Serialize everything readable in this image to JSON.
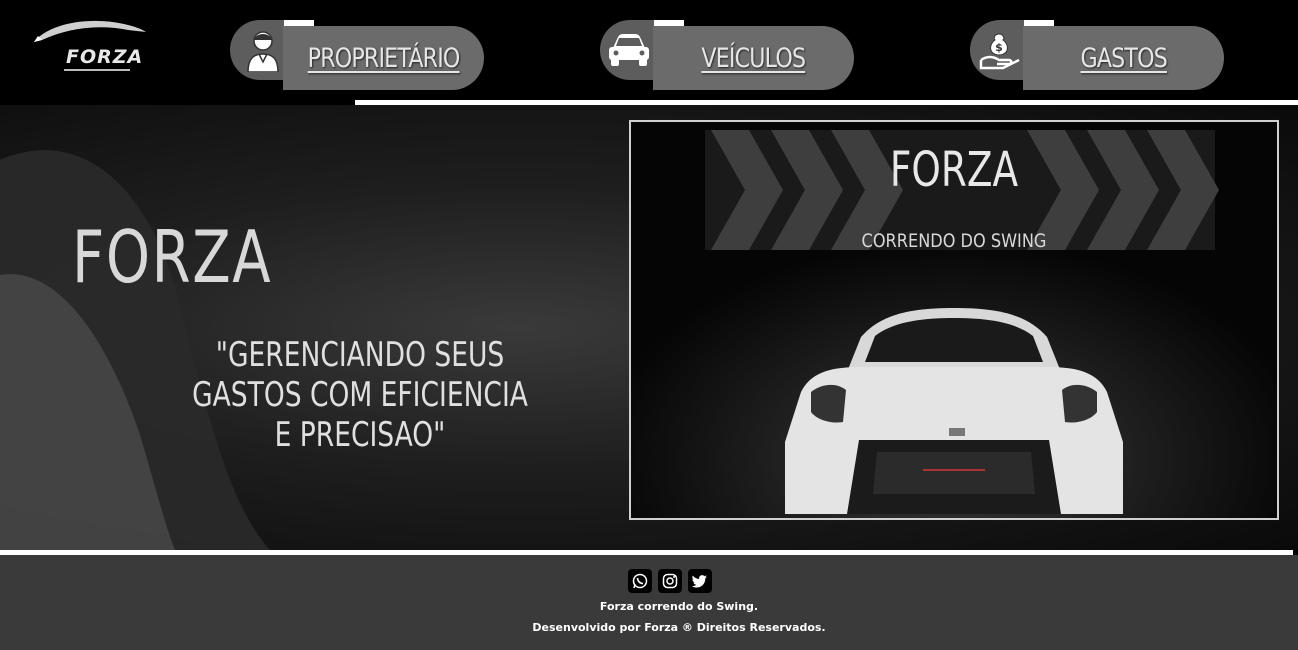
{
  "header": {
    "logo_text": "FORZA",
    "nav": [
      {
        "label": "PROPRIETÁRIO",
        "icon": "person-icon"
      },
      {
        "label": "VEÍCULOS",
        "icon": "car-icon"
      },
      {
        "label": "GASTOS",
        "icon": "money-hand-icon"
      }
    ]
  },
  "hero": {
    "title": "FORZA",
    "quote": "\"GERENCIANDO SEUS GASTOS COM EFICIENCIA E PRECISAO\"",
    "video": {
      "title": "FORZA",
      "subtitle": "CORRENDO DO SWING"
    }
  },
  "footer": {
    "social": [
      "whatsapp-icon",
      "instagram-icon",
      "twitter-icon"
    ],
    "line1": "Forza correndo do Swing.",
    "line2": "Desenvolvido por Forza ® Direitos Reservados."
  },
  "colors": {
    "background": "#000000",
    "nav_box": "#6b6b6b",
    "footer": "#3a3a3a"
  }
}
